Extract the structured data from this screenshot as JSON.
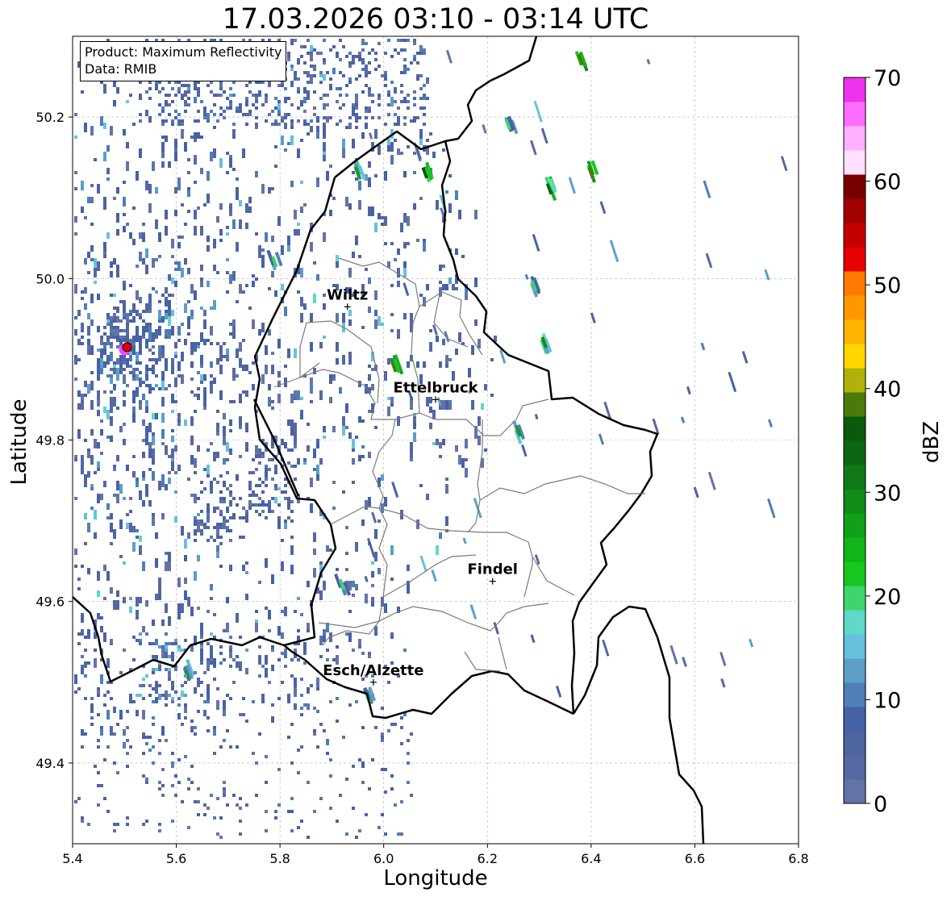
{
  "title": "17.03.2026 03:10 - 03:14 UTC",
  "info_box": {
    "product": "Product: Maximum Reflectivity",
    "data_source": "Data: RMIB"
  },
  "axes": {
    "xlabel": "Longitude",
    "ylabel": "Latitude",
    "xlim": [
      5.4,
      6.8
    ],
    "ylim": [
      49.3,
      50.3
    ],
    "xticks": [
      5.4,
      5.6,
      5.8,
      6.0,
      6.2,
      6.4,
      6.6,
      6.8
    ],
    "xtick_labels": [
      "5.4",
      "5.6",
      "5.8",
      "6.0",
      "6.2",
      "6.4",
      "6.6",
      "6.8"
    ],
    "yticks": [
      49.4,
      49.6,
      49.8,
      50.0,
      50.2
    ],
    "ytick_labels": [
      "49.4",
      "49.6",
      "49.8",
      "50.0",
      "50.2"
    ],
    "grid": true
  },
  "colorbar": {
    "label": "dBZ",
    "ticks": [
      "0",
      "10",
      "20",
      "30",
      "40",
      "50",
      "60",
      "70"
    ],
    "range": [
      0,
      70
    ],
    "step": 2.5,
    "colors": [
      "#6373a8",
      "#5568a3",
      "#4d64a0",
      "#4562a5",
      "#4e7fb8",
      "#5b9fc9",
      "#66c1dd",
      "#5ed8c7",
      "#3fd46c",
      "#17c71d",
      "#10b51a",
      "#10a01a",
      "#108c19",
      "#107818",
      "#0c6612",
      "#0a5a0e",
      "#4b7a0c",
      "#b0b20a",
      "#ffd600",
      "#ffb400",
      "#ff9800",
      "#ff7a00",
      "#e60000",
      "#c40000",
      "#a30000",
      "#7a0000",
      "#ffe0ff",
      "#ffb0ff",
      "#ff6cff",
      "#ee33ee"
    ]
  },
  "cities": [
    {
      "name": "Wiltz",
      "lon": 5.93,
      "lat": 49.965
    },
    {
      "name": "Ettelbruck",
      "lon": 6.1,
      "lat": 49.85
    },
    {
      "name": "Findel",
      "lon": 6.21,
      "lat": 49.625
    },
    {
      "name": "Esch/Alzette",
      "lon": 5.98,
      "lat": 49.5
    }
  ],
  "radar_site": {
    "lon": 5.505,
    "lat": 49.915,
    "color": "#e60000"
  },
  "chart_data": {
    "type": "map",
    "title": "17.03.2026 03:10 - 03:14 UTC",
    "xlabel": "Longitude",
    "ylabel": "Latitude",
    "xlim": [
      5.4,
      6.8
    ],
    "ylim": [
      49.3,
      50.3
    ],
    "colorbar_label": "dBZ",
    "colorbar_range": [
      0,
      70
    ],
    "cities": [
      "Wiltz",
      "Ettelbruck",
      "Findel",
      "Esch/Alzette"
    ],
    "reflectivity_cells": [
      {
        "lon": 5.68,
        "lat": 49.72,
        "dbz": 8
      },
      {
        "lon": 5.78,
        "lat": 49.75,
        "dbz": 8
      },
      {
        "lon": 5.5,
        "lat": 49.92,
        "dbz": 12
      },
      {
        "lon": 5.95,
        "lat": 50.13,
        "dbz": 28
      },
      {
        "lon": 6.08,
        "lat": 50.13,
        "dbz": 38
      },
      {
        "lon": 6.02,
        "lat": 49.89,
        "dbz": 40
      },
      {
        "lon": 6.29,
        "lat": 49.99,
        "dbz": 22
      },
      {
        "lon": 6.31,
        "lat": 49.92,
        "dbz": 30
      },
      {
        "lon": 6.32,
        "lat": 50.11,
        "dbz": 35
      },
      {
        "lon": 6.4,
        "lat": 50.13,
        "dbz": 40
      },
      {
        "lon": 6.38,
        "lat": 50.27,
        "dbz": 40
      },
      {
        "lon": 6.24,
        "lat": 50.19,
        "dbz": 22
      },
      {
        "lon": 5.97,
        "lat": 49.48,
        "dbz": 22
      },
      {
        "lon": 5.62,
        "lat": 49.51,
        "dbz": 28
      },
      {
        "lon": 5.57,
        "lat": 49.52,
        "dbz": 18
      },
      {
        "lon": 6.26,
        "lat": 49.81,
        "dbz": 28
      },
      {
        "lon": 5.79,
        "lat": 50.02,
        "dbz": 22
      },
      {
        "lon": 5.92,
        "lat": 49.62,
        "dbz": 22
      }
    ]
  }
}
